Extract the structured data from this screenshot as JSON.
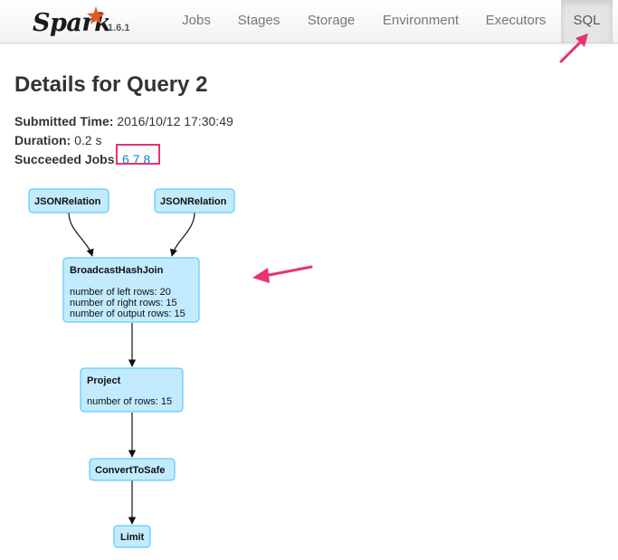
{
  "brand": {
    "name": "Spark",
    "version": "1.6.1"
  },
  "nav": {
    "tabs": [
      {
        "label": "Jobs",
        "active": false
      },
      {
        "label": "Stages",
        "active": false
      },
      {
        "label": "Storage",
        "active": false
      },
      {
        "label": "Environment",
        "active": false
      },
      {
        "label": "Executors",
        "active": false
      },
      {
        "label": "SQL",
        "active": true
      }
    ]
  },
  "page": {
    "title": "Details for Query 2"
  },
  "summary": {
    "submitted_label": "Submitted Time:",
    "submitted_value": "2016/10/12 17:30:49",
    "duration_label": "Duration:",
    "duration_value": "0.2 s",
    "jobs_label": "Succeeded Jobs:",
    "jobs": [
      "6",
      "7",
      "8"
    ]
  },
  "plan": {
    "nodes": {
      "json_left": {
        "title": "JSONRelation"
      },
      "json_right": {
        "title": "JSONRelation"
      },
      "join": {
        "title": "BroadcastHashJoin",
        "metrics": [
          "number of left rows: 20",
          "number of right rows: 15",
          "number of output rows: 15"
        ]
      },
      "project": {
        "title": "Project",
        "metrics": [
          "number of rows: 15"
        ]
      },
      "convert": {
        "title": "ConvertToSafe"
      },
      "limit": {
        "title": "Limit"
      }
    }
  },
  "colors": {
    "accent": "#e8336d",
    "link": "#0088cc",
    "node_fill": "#c3ebff",
    "node_stroke": "#3ec0ff",
    "spark_orange": "#e25a1c"
  }
}
